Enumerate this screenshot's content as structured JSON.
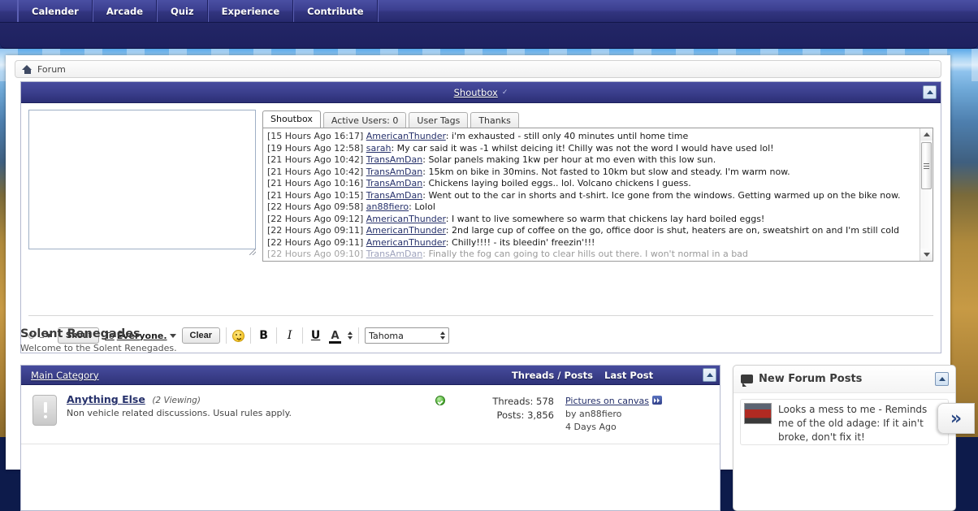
{
  "topnav": {
    "items": [
      {
        "label": "Calender"
      },
      {
        "label": "Arcade"
      },
      {
        "label": "Quiz"
      },
      {
        "label": "Experience"
      },
      {
        "label": "Contribute"
      }
    ]
  },
  "breadcrumb": {
    "home_icon": "home-icon",
    "label": "Forum"
  },
  "shoutbox": {
    "title": "Shoutbox",
    "collapse_icon": "collapse-up-icon",
    "input_placeholder": "",
    "input_value": "",
    "tabs": [
      {
        "label": "Shoutbox",
        "active": true
      },
      {
        "label": "Active Users: 0",
        "active": false
      },
      {
        "label": "User Tags",
        "active": false
      },
      {
        "label": "Thanks",
        "active": false
      }
    ],
    "messages": [
      {
        "time": "[15 Hours Ago 16:17]",
        "user": "AmericanThunder",
        "text": "i'm exhausted - still only 40 minutes until home time"
      },
      {
        "time": "[19 Hours Ago 12:58]",
        "user": "sarah",
        "text": "My car said it was -1 whilst deicing it! Chilly was not the word I would have used lol!"
      },
      {
        "time": "[21 Hours Ago 10:42]",
        "user": "TransAmDan",
        "text": "Solar panels making 1kw per hour at mo even with this low sun."
      },
      {
        "time": "[21 Hours Ago 10:42]",
        "user": "TransAmDan",
        "text": "15km on bike in 30mins. Not fasted to 10km but slow and steady. I'm warm now."
      },
      {
        "time": "[21 Hours Ago 10:16]",
        "user": "TransAmDan",
        "text": "Chickens laying boiled eggs.. lol. Volcano chickens I guess."
      },
      {
        "time": "[21 Hours Ago 10:15]",
        "user": "TransAmDan",
        "text": "Went out to the car in shorts and t-shirt. Ice gone from the windows. Getting warmed up on the bike now."
      },
      {
        "time": "[22 Hours Ago 09:58]",
        "user": "an88fiero",
        "text": "Lolol"
      },
      {
        "time": "[22 Hours Ago 09:12]",
        "user": "AmericanThunder",
        "text": "I want to live somewhere so warm that chickens lay hard boiled eggs!"
      },
      {
        "time": "[22 Hours Ago 09:11]",
        "user": "AmericanThunder",
        "text": "2nd large cup of coffee on the go, office door is shut, heaters are on, sweatshirt on and I'm still cold"
      },
      {
        "time": "[22 Hours Ago 09:11]",
        "user": "AmericanThunder",
        "text": "Chilly!!!! - its bleedin' freezin'!!!"
      },
      {
        "time": "[22 Hours Ago 09:10]",
        "user": "TransAmDan",
        "text": "Finally the fog can going to clear hills out there. I won't normal in a bad"
      }
    ],
    "toolbar": {
      "shout_label": "Shout",
      "to_label_prefix": "To ",
      "to_label_strong": "Everyone.",
      "clear_label": "Clear",
      "smiley_icon": "smiley-icon",
      "bold_label": "B",
      "italic_label": "I",
      "underline_label": "U",
      "font_color_label": "A",
      "font_family_value": "Tahoma"
    },
    "scrollbar": {
      "up_icon": "scroll-up-arrow-icon",
      "down_icon": "scroll-down-arrow-icon"
    }
  },
  "site": {
    "title": "Solent Renegades",
    "subtitle": "Welcome to the Solent Renegades."
  },
  "category": {
    "name": "Main Category",
    "col_threads_posts": "Threads / Posts",
    "col_last_post": "Last Post",
    "collapse_icon": "collapse-up-icon",
    "forums": [
      {
        "icon": "forum-unread-icon",
        "title": "Anything Else",
        "viewing": "(2 Viewing)",
        "description": "Non vehicle related discussions. Usual rules apply.",
        "status_icon": "status-ok-icon",
        "threads": "Threads: 578",
        "posts": "Posts: 3,856",
        "last_post_title": "Pictures on canvas",
        "last_post_jump_icon": "go-to-last-post-icon",
        "last_post_by": "by an88fiero",
        "last_post_time": "4 Days Ago"
      }
    ]
  },
  "sidebar": {
    "title": "New Forum Posts",
    "bubble_icon": "speech-bubble-icon",
    "collapse_icon": "collapse-up-icon",
    "posts": [
      {
        "thumb": "car-thumbnail",
        "text": "Looks a mess to me - Reminds me of the old adage: If it ain't broke, don't fix it!"
      }
    ]
  },
  "expand_button": {
    "label": "»",
    "icon": "double-chevron-right-icon"
  }
}
